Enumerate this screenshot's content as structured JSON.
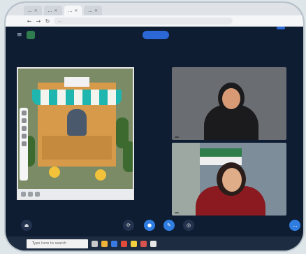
{
  "browser": {
    "tabs": [
      {
        "label": "...",
        "active": false
      },
      {
        "label": "...",
        "active": false
      },
      {
        "label": "...",
        "active": true
      },
      {
        "label": "...",
        "active": false
      }
    ],
    "url": "..."
  },
  "meeting": {
    "title": "",
    "record_label": "",
    "chat_label": ""
  },
  "screen_share": {
    "sign_text": "",
    "bottom_bar": {
      "page_label": "",
      "pager": ""
    }
  },
  "tiles": [
    {
      "name": ""
    },
    {
      "name": ""
    }
  ],
  "taskbar": {
    "search_placeholder": "Type here to search"
  }
}
